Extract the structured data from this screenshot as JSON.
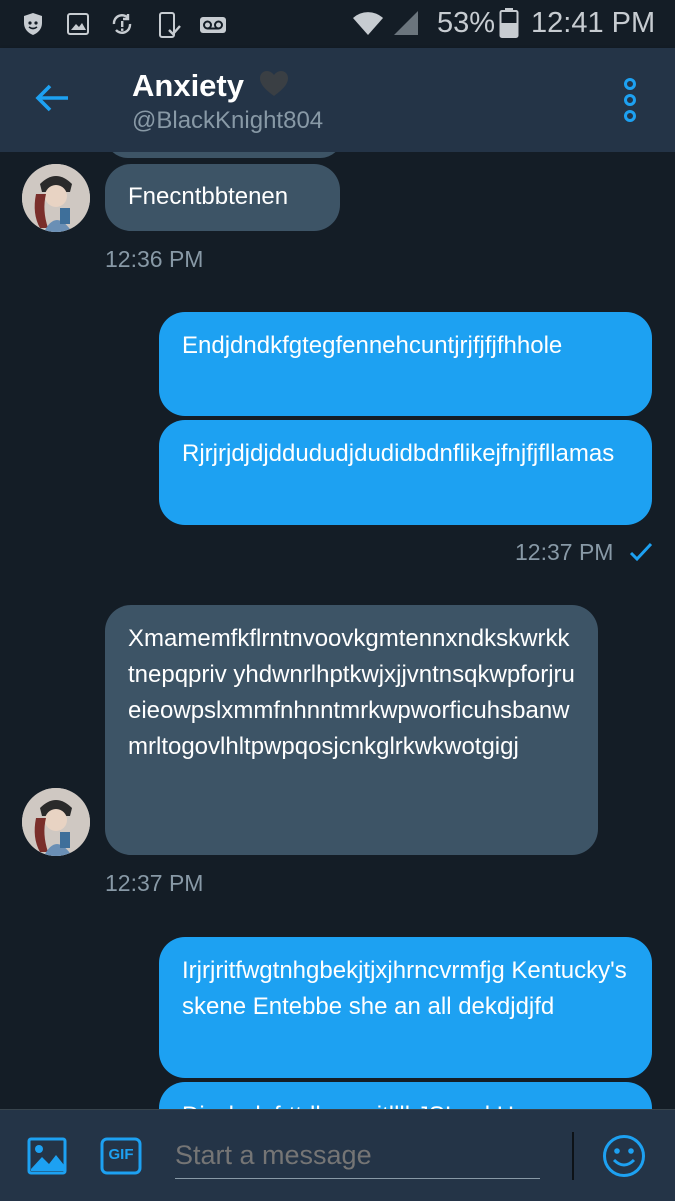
{
  "status_bar": {
    "battery_percent": "53%",
    "time": "12:41 PM"
  },
  "header": {
    "name": "Anxiety",
    "handle": "@BlackKnight804"
  },
  "messages": [
    {
      "text": "Fnecntbbtenen"
    },
    {
      "text": "Endjdndkfgtegfennehcuntjrjfjfjfhhole"
    },
    {
      "text": "Rjrjrjdjdjddududjdudidbdnflikejfnjfjfllamas"
    },
    {
      "text": "Xmamemfkflrntnvoovkgmtennxndkskwrkktnepqpriv yhdwnrlhptkwjxjjvntnsqkwpforjrueieowpslxmmfnhnntmrkwpworficuhsbanwmrltogovlhltpwpqosjcnkglrkwkwotgigj"
    },
    {
      "text": "Irjrjritfwgtnhgbekjtjxjhrncvrmfjg Kentucky's skene Entebbe she an all dekdjdjfd"
    },
    {
      "text": "Djrrdndnfrttdbennritllll JSIcnd Hv"
    }
  ],
  "timestamps": [
    "12:36 PM",
    "12:37 PM",
    "12:37 PM"
  ],
  "composer": {
    "placeholder": "Start a message",
    "gif_label": "GIF"
  },
  "colors": {
    "accent": "#1da1f2",
    "background": "#141d26",
    "appbar": "#243447",
    "incoming_bubble": "#3d5466"
  }
}
